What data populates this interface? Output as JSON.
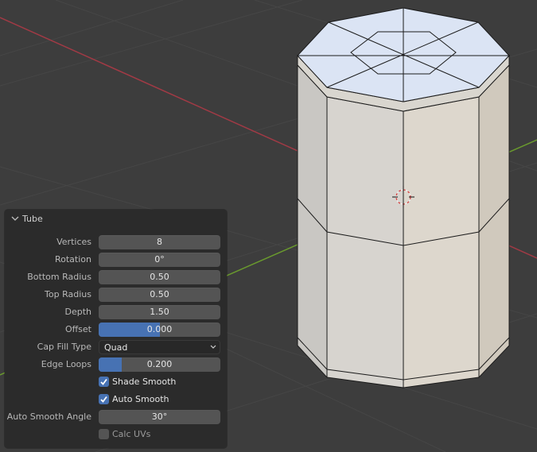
{
  "panel": {
    "title": "Tube",
    "rows": [
      {
        "label": "Vertices",
        "value": "8"
      },
      {
        "label": "Rotation",
        "value": "0°"
      },
      {
        "label": "Bottom Radius",
        "value": "0.50"
      },
      {
        "label": "Top Radius",
        "value": "0.50"
      },
      {
        "label": "Depth",
        "value": "1.50"
      },
      {
        "label": "Offset",
        "value": "0.000",
        "fill_fraction": 0.5
      },
      {
        "label": "Cap Fill Type",
        "value": "Quad"
      },
      {
        "label": "Edge Loops",
        "value": "0.200",
        "fill_fraction": 0.19
      }
    ],
    "checks": [
      {
        "label": "Shade Smooth",
        "checked": true
      },
      {
        "label": "Auto Smooth",
        "checked": true
      }
    ],
    "auto_smooth_angle": {
      "label": "Auto Smooth Angle",
      "value": "30°"
    },
    "calc_uvs": {
      "label": "Calc UVs",
      "checked": false
    }
  },
  "colors": {
    "accent": "#4772b3",
    "panel_bg": "#2b2b2b",
    "field_bg": "#545454",
    "viewport_bg": "#3d3d3d",
    "axis_x": "#a13a45",
    "axis_y": "#6a9a2e"
  }
}
